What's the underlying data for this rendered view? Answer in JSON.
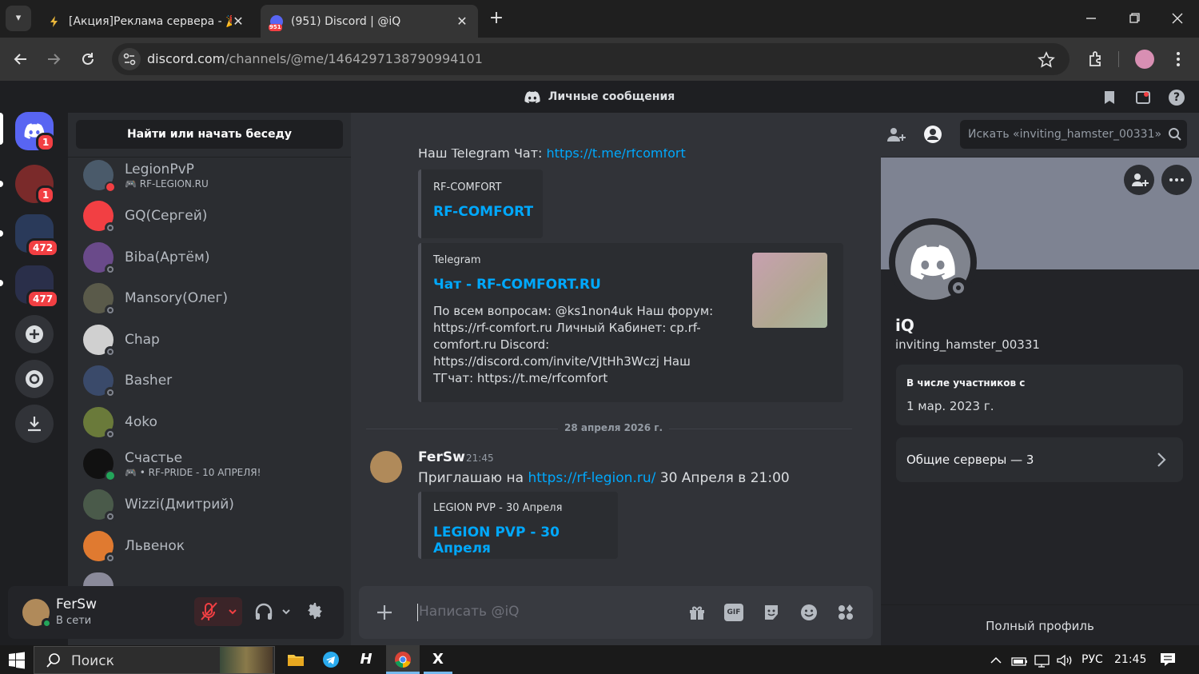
{
  "browser": {
    "tabs": [
      {
        "title": "[Акция]Реклама сервера - 🎉 I",
        "active": false
      },
      {
        "title": "(951) Discord | @iQ",
        "active": true,
        "favicon_badge": "951"
      }
    ],
    "url_host": "discord.com",
    "url_path": "/channels/@me/1464297138790994101"
  },
  "discord": {
    "top_title": "Личные сообщения",
    "home_badge": "1",
    "server_badges": [
      "1",
      "472",
      "477"
    ],
    "find_button": "Найти или начать беседу",
    "dms": [
      {
        "name": "LegionPvP",
        "activity": "RF-LEGION.RU",
        "color": "#4a5a6a",
        "status": "dnd"
      },
      {
        "name": "GQ(Сергей)",
        "activity": "",
        "color": "#f23f43",
        "status": "offline"
      },
      {
        "name": "Biba(Артём)",
        "activity": "",
        "color": "#6a4a8a",
        "status": "offline"
      },
      {
        "name": "Mansory(Олег)",
        "activity": "",
        "color": "#5a5a4a",
        "status": "offline"
      },
      {
        "name": "Chap",
        "activity": "",
        "color": "#d0d0d0",
        "status": "offline"
      },
      {
        "name": "Basher",
        "activity": "",
        "color": "#3a4a6a",
        "status": "offline"
      },
      {
        "name": "4oko",
        "activity": "",
        "color": "#6a7a3a",
        "status": "offline"
      },
      {
        "name": "Счастье",
        "activity": "• RF-PRIDE - 10 АПРЕЛЯ!",
        "color": "#111111",
        "status": "online"
      },
      {
        "name": "Wizzi(Дмитрий)",
        "activity": "",
        "color": "#4a5a4a",
        "status": "offline"
      },
      {
        "name": "Львенок",
        "activity": "",
        "color": "#e07a30",
        "status": "offline"
      }
    ],
    "user": {
      "name": "FerSw",
      "status": "В сети"
    },
    "chat": {
      "recipient": "iQ",
      "search_placeholder": "Искать «inviting_hamster_00331»",
      "cut_line_prefix": "Наш Telegram Чат: ",
      "cut_line_link": "https://t.me/rfcomfort",
      "embed1": {
        "provider": "RF-COMFORT",
        "title": "RF-COMFORT"
      },
      "embed2": {
        "provider": "Telegram",
        "title": "Чат - RF-COMFORT.RU",
        "description": "По всем вопросам: @ks1non4uk Наш форум: https://rf-comfort.ru Личный Кабинет: cp.rf-comfort.ru Discord: https://discord.com/invite/VJtHh3Wczj Наш ТГчат: https://t.me/rfcomfort"
      },
      "date_divider": "28 апреля 2026 г.",
      "message": {
        "author": "FerSw",
        "time": "21:45",
        "text_before": "Приглашаю на ",
        "link": "https://rf-legion.ru/",
        "text_after": " 30 Апреля в 21:00"
      },
      "embed3": {
        "provider": "LEGION PVP - 30 Апреля",
        "title": "LEGION PVP - 30 Апреля"
      },
      "composer_placeholder": "Написать @iQ"
    },
    "profile": {
      "display_name": "iQ",
      "username": "inviting_hamster_00331",
      "member_since_label": "В числе участников с",
      "member_since": "1 мар. 2023 г.",
      "mutual_servers": "Общие серверы — 3",
      "full_profile": "Полный профиль"
    }
  },
  "taskbar": {
    "search_label": "Поиск",
    "lang": "РУС",
    "clock": "21:45"
  },
  "colors": {
    "blurple": "#5865f2",
    "link": "#00a8fc",
    "danger": "#f23f43",
    "online": "#23a55a"
  }
}
